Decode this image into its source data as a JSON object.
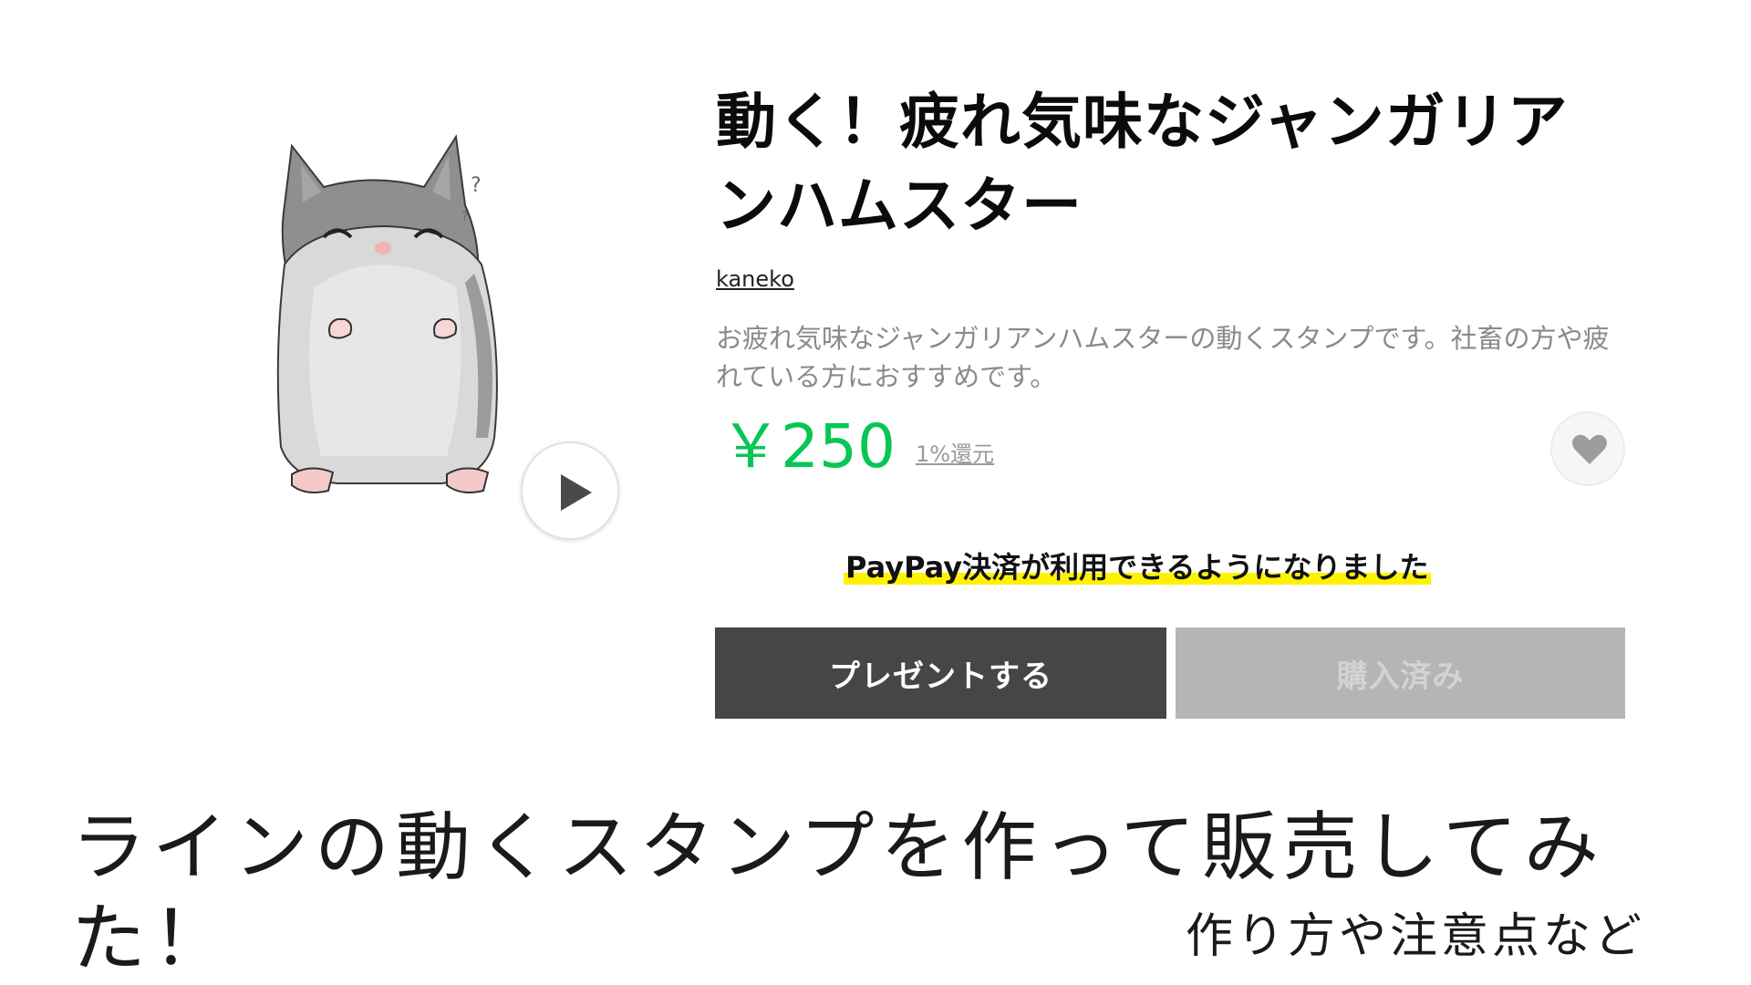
{
  "product": {
    "title": "動く！疲れ気味なジャンガリアンハムスター",
    "author": "kaneko",
    "description": "お疲れ気味なジャンガリアンハムスターの動くスタンプです。社畜の方や疲れている方におすすめです。",
    "price": "￥250",
    "cashback": "1%還元",
    "price_color": "#06c755"
  },
  "notice": "PayPay決済が利用できるようになりました",
  "actions": {
    "gift_label": "プレゼントする",
    "purchased_label": "購入済み"
  },
  "icons": {
    "play": "play-icon",
    "favorite": "heart-icon"
  },
  "caption": {
    "main": "ラインの動くスタンプを作って販売してみた！",
    "sub": "作り方や注意点など"
  }
}
